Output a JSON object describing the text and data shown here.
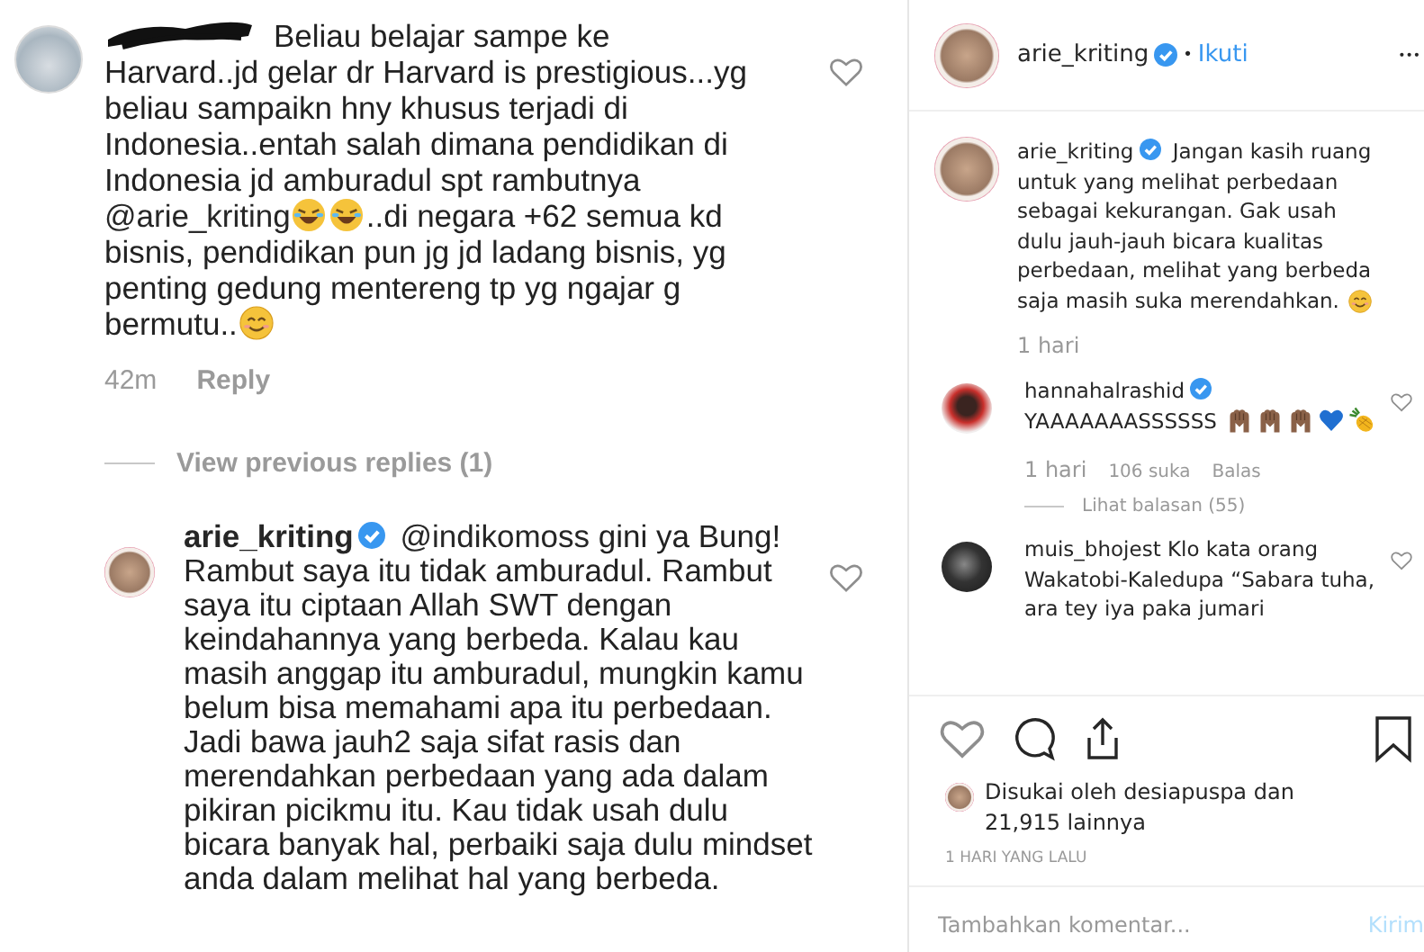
{
  "left": {
    "comment": {
      "redacted": true,
      "parts": [
        {
          "kind": "text",
          "text": "Beliau belajar sampe ke Harvard..jd gelar dr Harvard is prestigious...yg beliau sampaikn hny khusus terjadi di Indonesia..entah salah dimana pendidikan di Indonesia jd amburadul spt rambutnya "
        },
        {
          "kind": "mention",
          "text": "@arie_kriting"
        },
        {
          "kind": "laughing"
        },
        {
          "kind": "laughing"
        },
        {
          "kind": "text",
          "text": "..di negara +62 semua kd bisnis, pendidikan pun jg jd ladang bisnis, yg penting gedung mentereng tp yg ngajar g bermutu.."
        },
        {
          "kind": "smiling"
        }
      ],
      "time": "42m",
      "reply": "Reply"
    },
    "view_replies": "View previous replies (1)",
    "reply": {
      "parts": [
        {
          "kind": "user",
          "text": "arie_kriting",
          "verified": true
        },
        {
          "kind": "mention",
          "text": " @indikomoss"
        },
        {
          "kind": "text",
          "text": " gini ya Bung! Rambut saya itu tidak amburadul. Rambut saya itu ciptaan Allah SWT dengan keindahannya yang berbeda. Kalau kau masih anggap itu amburadul, mungkin kamu belum bisa memahami apa itu perbedaan. Jadi bawa jauh2 saja sifat rasis dan merendahkan perbedaan yang ada dalam pikiran picikmu itu. Kau tidak usah dulu bicara banyak hal, perbaiki saja dulu mindset anda dalam melihat hal yang berbeda."
        }
      ]
    }
  },
  "right": {
    "header": {
      "username": "arie_kriting",
      "verified": true,
      "separator": "•",
      "follow": "Ikuti",
      "more": "•••"
    },
    "caption": {
      "parts": [
        {
          "kind": "user",
          "text": "arie_kriting",
          "verified": true
        },
        {
          "kind": "text",
          "text": " Jangan kasih ruang untuk yang melihat perbedaan sebagai kekurangan. Gak usah dulu jauh-jauh bicara kualitas perbedaan, melihat yang berbeda saja masih suka merendahkan. "
        },
        {
          "kind": "smiling"
        }
      ],
      "time": "1 hari"
    },
    "comments": [
      {
        "kind": "portrait",
        "parts": [
          {
            "kind": "user",
            "text": "hannahalrashid",
            "verified": true
          },
          {
            "kind": "text",
            "text": " YAAAAAAASSSSSS "
          },
          {
            "kind": "hands"
          },
          {
            "kind": "hands"
          },
          {
            "kind": "hands"
          },
          {
            "kind": "heart"
          },
          {
            "kind": "pineapple"
          }
        ],
        "time": "1 hari",
        "likes": "106 suka",
        "reply": "Balas",
        "view_replies": "Lihat balasan (55)"
      },
      {
        "kind": "dark",
        "parts": [
          {
            "kind": "user",
            "text": "muis_bhojest",
            "verified": false
          },
          {
            "kind": "text",
            "text": " Klo kata orang Wakatobi-Kaledupa “Sabara tuha, ara tey iya paka jumari"
          }
        ]
      }
    ],
    "liked_by": "Disukai oleh desiapuspa dan 21,915 lainnya",
    "date": "1 HARI YANG LALU",
    "comment_field": {
      "placeholder": "Tambahkan komentar...",
      "send": "Kirim",
      "disabled": true
    }
  }
}
